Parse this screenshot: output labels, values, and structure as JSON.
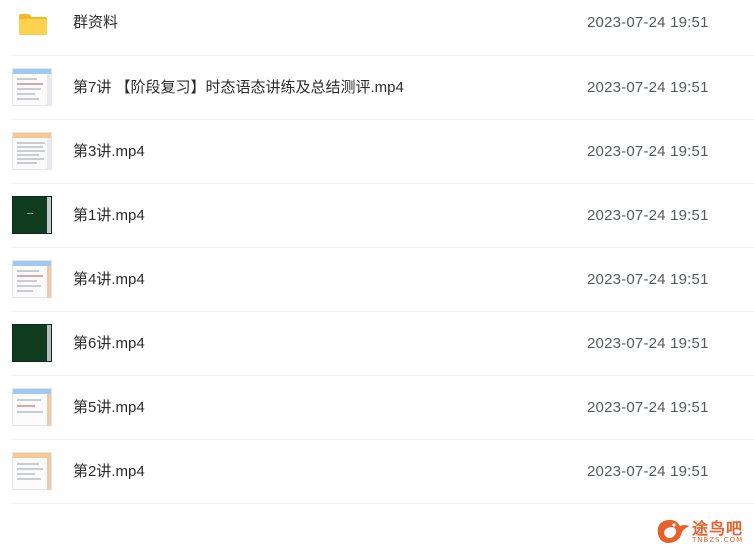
{
  "files": [
    {
      "name": "群资料",
      "date": "2023-07-24 19:51",
      "kind": "folder-icon"
    },
    {
      "name": "第7讲 【阶段复习】时态语态讲练及总结测评.mp4",
      "date": "2023-07-24 19:51",
      "kind": "video-thumbnail"
    },
    {
      "name": "第3讲.mp4",
      "date": "2023-07-24 19:51",
      "kind": "video-thumbnail"
    },
    {
      "name": "第1讲.mp4",
      "date": "2023-07-24 19:51",
      "kind": "video-thumbnail"
    },
    {
      "name": "第4讲.mp4",
      "date": "2023-07-24 19:51",
      "kind": "video-thumbnail"
    },
    {
      "name": "第6讲.mp4",
      "date": "2023-07-24 19:51",
      "kind": "video-thumbnail"
    },
    {
      "name": "第5讲.mp4",
      "date": "2023-07-24 19:51",
      "kind": "video-thumbnail"
    },
    {
      "name": "第2讲.mp4",
      "date": "2023-07-24 19:51",
      "kind": "video-thumbnail"
    }
  ],
  "watermark": {
    "text": "途鸟吧",
    "sub": "TNBZS.COM",
    "color": "#e8602c"
  },
  "colors": {
    "folder": "#f9c53b",
    "thumb_dark": "#0f3b1e",
    "thumb_blue_bar": "#8fc3ea",
    "thumb_orange_bar": "#f3c08a",
    "divider": "#eef0f2"
  }
}
